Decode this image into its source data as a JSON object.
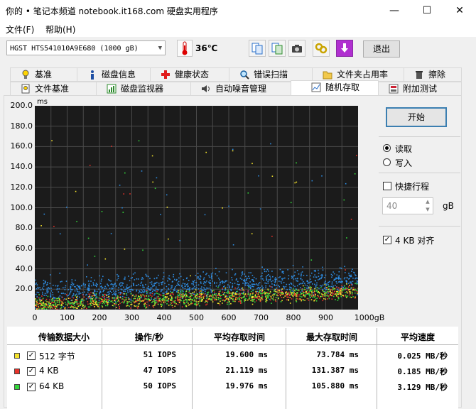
{
  "window": {
    "title": "你的 • 笔记本频道 notebook.it168.com  硬盘实用程序"
  },
  "menu": [
    {
      "label": "文件(F)"
    },
    {
      "label": "帮助(H)"
    }
  ],
  "toolbar": {
    "disk": "HGST HTS541010A9E680 (1000 gB)",
    "temperature": "36℃",
    "exit_label": "退出"
  },
  "tabs_row1": [
    {
      "label": "基准",
      "icon": "lightbulb-icon"
    },
    {
      "label": "磁盘信息",
      "icon": "info-icon"
    },
    {
      "label": "健康状态",
      "icon": "health-cross-icon"
    },
    {
      "label": "错误扫描",
      "icon": "magnifier-icon"
    },
    {
      "label": "文件夹占用率",
      "icon": "folder-icon"
    },
    {
      "label": "擦除",
      "icon": "trash-icon"
    }
  ],
  "tabs_row2": [
    {
      "label": "文件基准",
      "icon": "file-bench-icon"
    },
    {
      "label": "磁盘监视器",
      "icon": "monitor-icon"
    },
    {
      "label": "自动噪音管理",
      "icon": "speaker-icon"
    },
    {
      "label": "随机存取",
      "icon": "random-access-icon",
      "active": true
    },
    {
      "label": "附加测试",
      "icon": "extra-test-icon"
    }
  ],
  "controls": {
    "start_label": "开始",
    "read_label": "读取",
    "write_label": "写入",
    "mode": "read",
    "quick_label": "快捷行程",
    "quick_checked": false,
    "quick_value": "40",
    "quick_unit": "gB",
    "align_label": "4 KB 对齐",
    "align_checked": true
  },
  "chart_data": {
    "type": "scatter",
    "ylabel": "ms",
    "xlabel": "1000gB",
    "ylim": [
      0,
      200
    ],
    "xlim": [
      0,
      1000
    ],
    "yticks": [
      "200.0",
      "180.0",
      "160.0",
      "140.0",
      "120.0",
      "100.0",
      "80.0",
      "60.0",
      "40.0",
      "20.0"
    ],
    "xticks": [
      "0",
      "100",
      "200",
      "300",
      "400",
      "500",
      "600",
      "700",
      "800",
      "900",
      "1000gB"
    ],
    "background": "#1b1b1b",
    "series": [
      {
        "name": "512 字节",
        "color": "#f5e32c",
        "avg_ms": 19.6
      },
      {
        "name": "4 KB",
        "color": "#e8322a",
        "avg_ms": 21.119
      },
      {
        "name": "64 KB",
        "color": "#33d63a",
        "avg_ms": 19.976
      },
      {
        "name": "",
        "color": "#2d8be0",
        "avg_ms": 30.0
      }
    ]
  },
  "table": {
    "headers": [
      "传输数据大小",
      "操作/秒",
      "平均存取时间",
      "最大存取时间",
      "平均速度"
    ],
    "rows": [
      {
        "color": "#f5e32c",
        "label": "512 字节",
        "iops": "51 IOPS",
        "avg": "19.600 ms",
        "max": "73.784 ms",
        "speed": "0.025 MB/秒"
      },
      {
        "color": "#e8322a",
        "label": "4 KB",
        "iops": "47 IOPS",
        "avg": "21.119 ms",
        "max": "131.387 ms",
        "speed": "0.185 MB/秒"
      },
      {
        "color": "#33d63a",
        "label": "64 KB",
        "iops": "50 IOPS",
        "avg": "19.976 ms",
        "max": "105.880 ms",
        "speed": "3.129 MB/秒"
      }
    ]
  }
}
